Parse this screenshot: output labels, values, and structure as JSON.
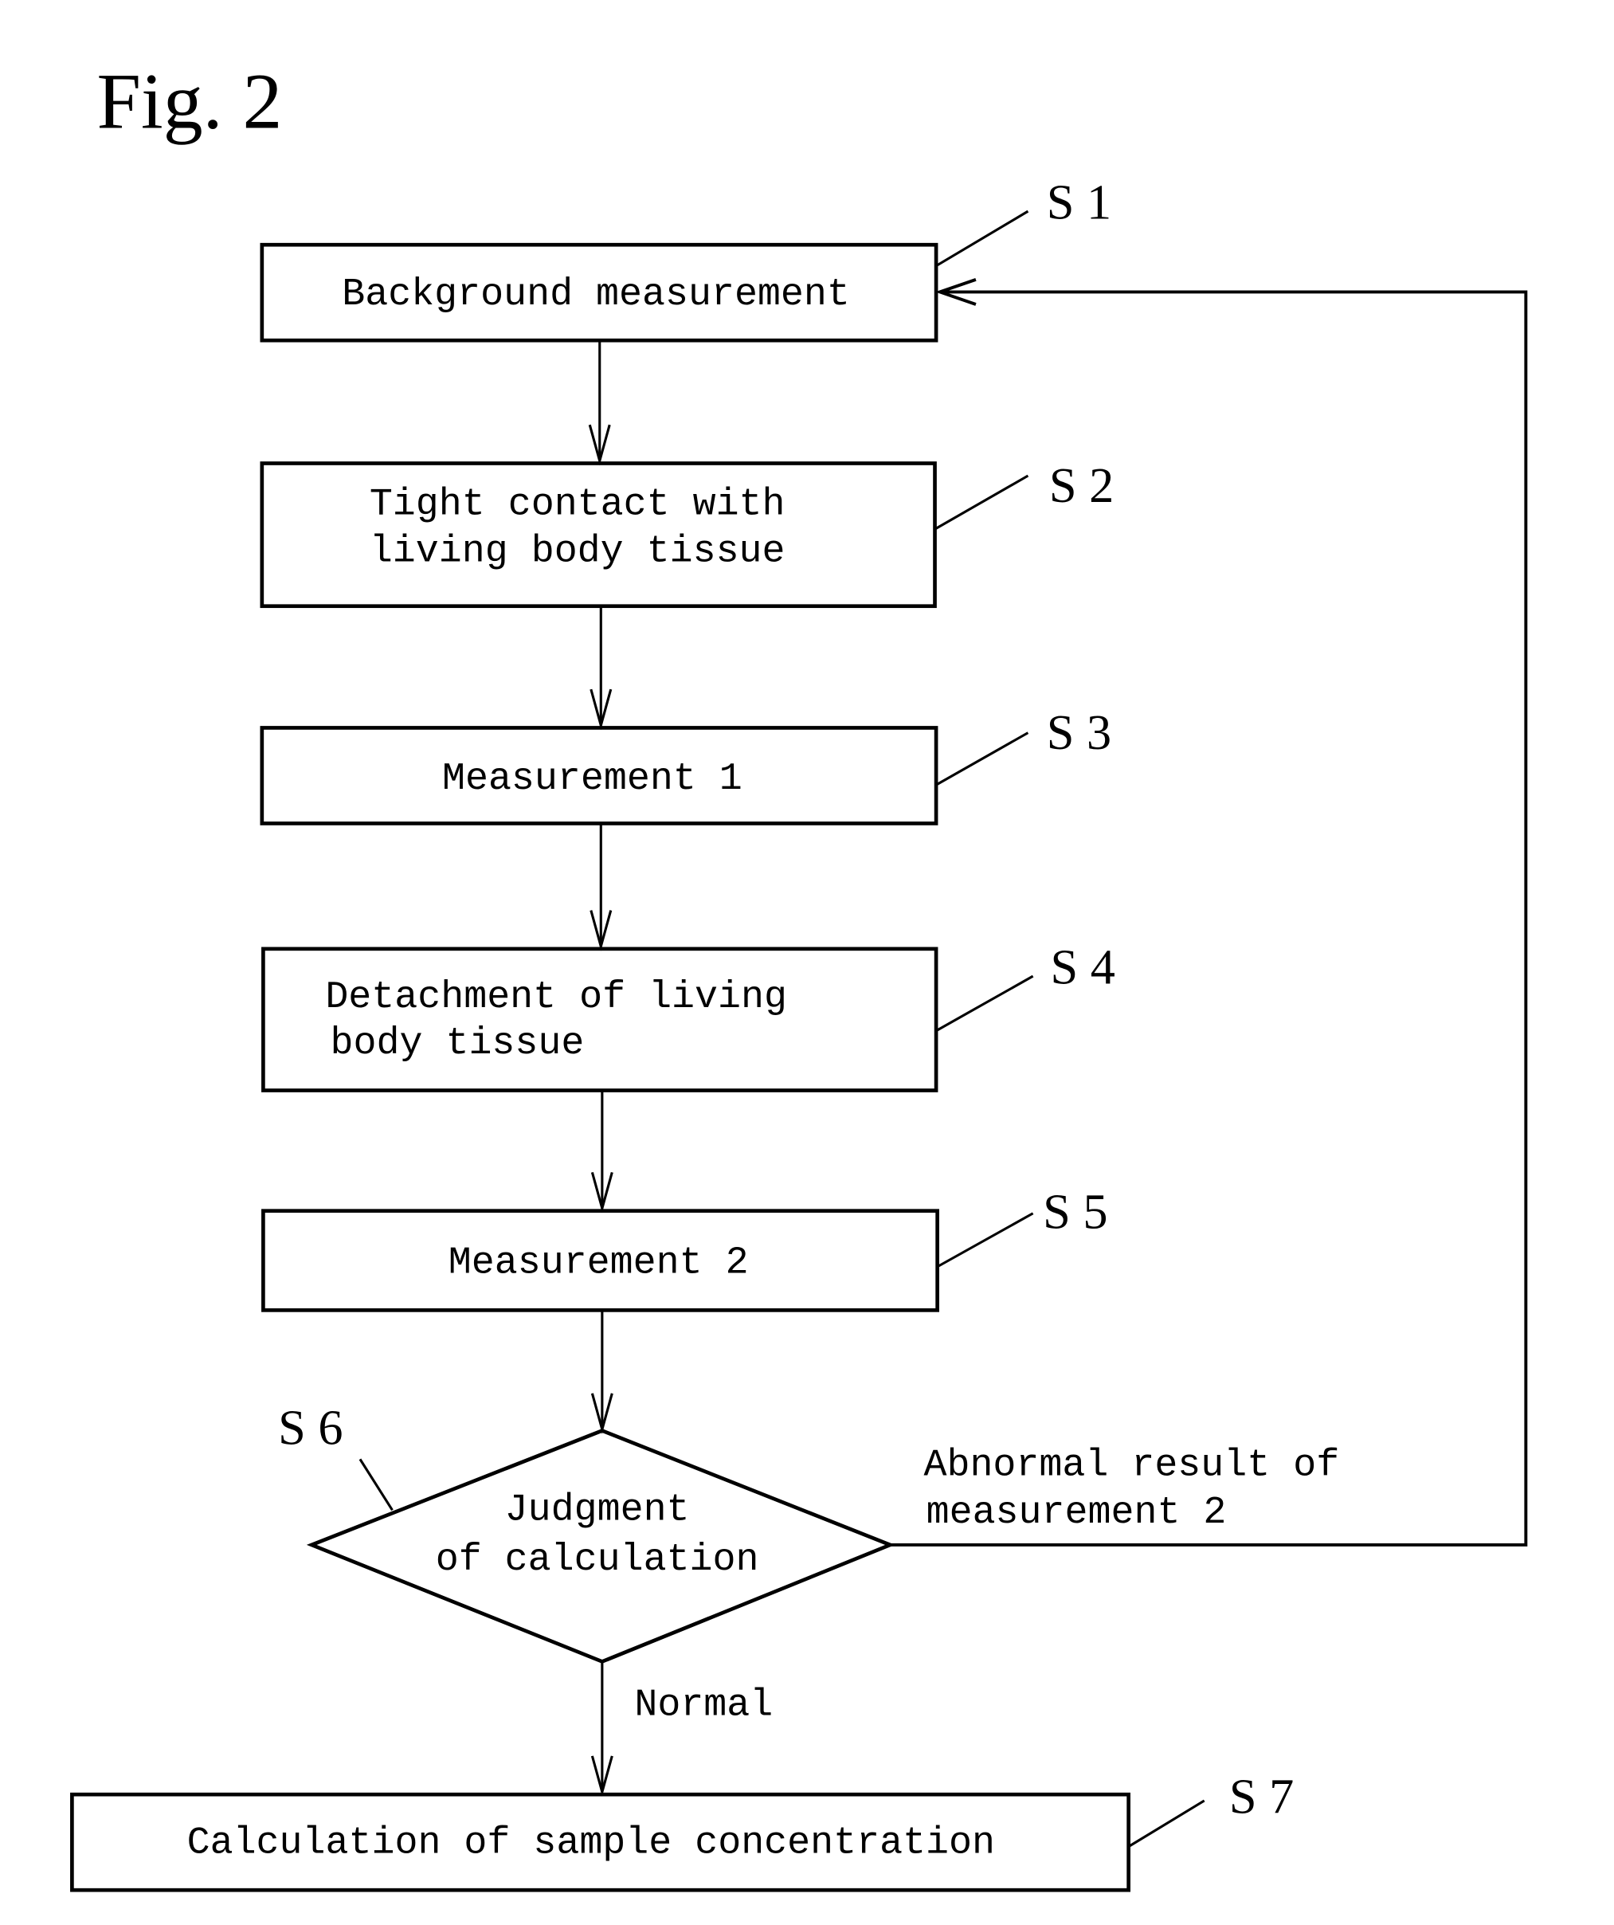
{
  "figure_title": "Fig. 2",
  "steps": [
    {
      "id": "S1",
      "label": "S 1",
      "lines": [
        "Background measurement"
      ]
    },
    {
      "id": "S2",
      "label": "S 2",
      "lines": [
        "Tight contact with",
        "living body tissue"
      ]
    },
    {
      "id": "S3",
      "label": "S 3",
      "lines": [
        "Measurement 1"
      ]
    },
    {
      "id": "S4",
      "label": "S 4",
      "lines": [
        "Detachment of living",
        "body tissue"
      ]
    },
    {
      "id": "S5",
      "label": "S 5",
      "lines": [
        "Measurement 2"
      ]
    },
    {
      "id": "S6",
      "label": "S 6",
      "lines": [
        "Judgment",
        "of calculation"
      ]
    },
    {
      "id": "S7",
      "label": "S 7",
      "lines": [
        "Calculation of sample concentration"
      ]
    }
  ],
  "edges": {
    "abnormal_label": [
      "Abnormal result of",
      "measurement 2"
    ],
    "normal_label": "Normal"
  }
}
